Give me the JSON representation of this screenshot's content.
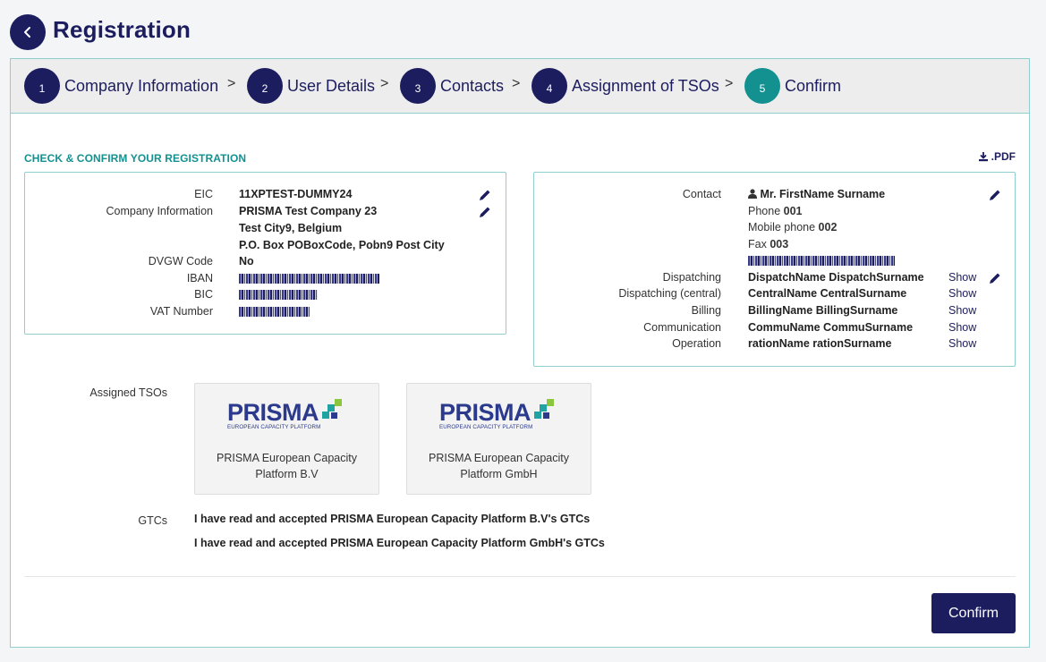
{
  "header": {
    "title": "Registration"
  },
  "stepper": {
    "steps": [
      {
        "number": "1",
        "label": "Company Information"
      },
      {
        "number": "2",
        "label": "User Details"
      },
      {
        "number": "3",
        "label": "Contacts"
      },
      {
        "number": "4",
        "label": "Assignment of TSOs"
      },
      {
        "number": "5",
        "label": "Confirm"
      }
    ],
    "separator": ">"
  },
  "section_title": "CHECK & CONFIRM YOUR REGISTRATION",
  "pdf_label": ".PDF",
  "company": {
    "eic_label": "EIC",
    "eic_value": "11XPTEST-DUMMY24",
    "company_label": "Company Information",
    "company_name": "PRISMA Test Company 23",
    "address_line1": "Test City9, Belgium",
    "address_line2": "P.O. Box POBoxCode, Pobn9 Post City",
    "dvgw_label": "DVGW Code",
    "dvgw_value": "No",
    "iban_label": "IBAN",
    "bic_label": "BIC",
    "vat_label": "VAT Number"
  },
  "contacts": {
    "contact_label": "Contact",
    "contact_name": "Mr. FirstName Surname",
    "phone_label": "Phone",
    "phone_value": "001",
    "mobile_label": "Mobile phone",
    "mobile_value": "002",
    "fax_label": "Fax",
    "fax_value": "003",
    "show_label": "Show",
    "roles": [
      {
        "label": "Dispatching",
        "name": "DispatchName DispatchSurname"
      },
      {
        "label": "Dispatching (central)",
        "name": "CentralName CentralSurname"
      },
      {
        "label": "Billing",
        "name": "BillingName BillingSurname"
      },
      {
        "label": "Communication",
        "name": "CommuName CommuSurname"
      },
      {
        "label": "Operation",
        "name": "rationName rationSurname"
      }
    ]
  },
  "tsos": {
    "label": "Assigned TSOs",
    "logo_text": "PRISMA",
    "logo_subtext": "EUROPEAN CAPACITY PLATFORM",
    "items": [
      {
        "name": "PRISMA European Capacity Platform B.V"
      },
      {
        "name": "PRISMA European Capacity Platform GmbH"
      }
    ]
  },
  "gtcs": {
    "label": "GTCs",
    "lines": [
      "I have read and accepted PRISMA European Capacity Platform B.V's GTCs",
      "I have read and accepted PRISMA European Capacity Platform GmbH's GTCs"
    ]
  },
  "confirm_button": "Confirm",
  "colors": {
    "navy": "#1c1d5e",
    "teal": "#139191",
    "border": "#8fcfcf"
  }
}
